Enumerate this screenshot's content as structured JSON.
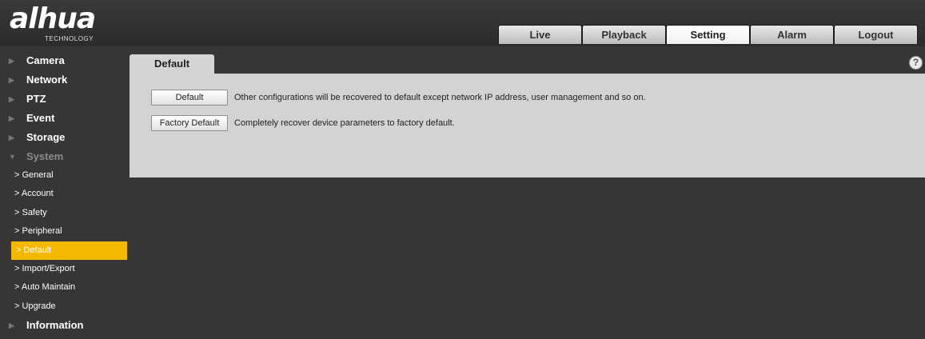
{
  "header": {
    "logo_text": "alhua",
    "logo_sub": "TECHNOLOGY",
    "nav": [
      {
        "label": "Live"
      },
      {
        "label": "Playback"
      },
      {
        "label": "Setting"
      },
      {
        "label": "Alarm"
      },
      {
        "label": "Logout"
      }
    ],
    "active_nav": "Setting"
  },
  "sidebar": {
    "items": [
      {
        "label": "Camera"
      },
      {
        "label": "Network"
      },
      {
        "label": "PTZ"
      },
      {
        "label": "Event"
      },
      {
        "label": "Storage"
      },
      {
        "label": "System"
      }
    ],
    "system_sub": [
      {
        "label": "> General"
      },
      {
        "label": "> Account"
      },
      {
        "label": "> Safety"
      },
      {
        "label": "> Peripheral"
      },
      {
        "label": "> Default"
      },
      {
        "label": "> Import/Export"
      },
      {
        "label": "> Auto Maintain"
      },
      {
        "label": "> Upgrade"
      }
    ],
    "last_item": {
      "label": "Information"
    },
    "active_sub": "> Default"
  },
  "content": {
    "tab_label": "Default",
    "help_icon": "?",
    "rows": [
      {
        "button": "Default",
        "description": "Other configurations will be recovered to default except network IP address, user management and so on."
      },
      {
        "button": "Factory Default",
        "description": "Completely recover device parameters to factory default."
      }
    ]
  },
  "colors": {
    "background": "#363636",
    "panel": "#d3d3d3",
    "active_highlight": "#f5b800"
  },
  "icons": {
    "help": "help-icon",
    "sidebar_arrow": "triangle-right-icon"
  }
}
